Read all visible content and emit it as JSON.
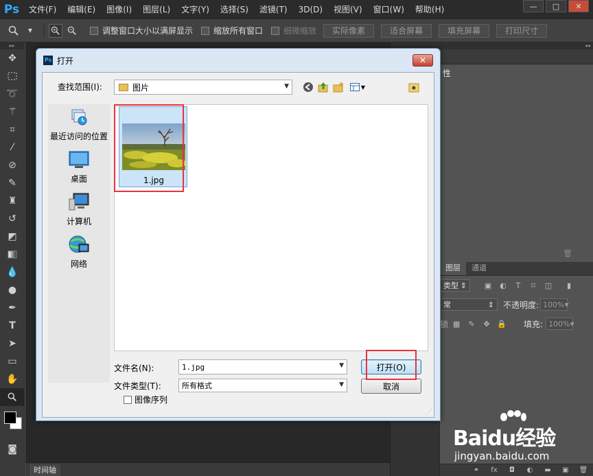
{
  "app": {
    "logo": "Ps",
    "menus": [
      "文件(F)",
      "编辑(E)",
      "图像(I)",
      "图层(L)",
      "文字(Y)",
      "选择(S)",
      "滤镜(T)",
      "3D(D)",
      "视图(V)",
      "窗口(W)",
      "帮助(H)"
    ],
    "window_controls": {
      "minimize": "—",
      "maximize": "□",
      "close": "✕"
    }
  },
  "options_bar": {
    "resize_windows_label": "调整窗口大小以满屏显示",
    "zoom_all_label": "缩放所有窗口",
    "scrubby_label": "细微缩放",
    "actual_pixels": "实际像素",
    "fit_screen": "适合屏幕",
    "fill_screen": "填充屏幕",
    "print_size": "打印尺寸"
  },
  "panels": {
    "properties_title": "性",
    "layers_tab": "图层",
    "channels_tab": "通道",
    "kind_label": "类型",
    "blend_mode": "常",
    "opacity_label": "不透明度:",
    "opacity_value": "100%",
    "lock_label": "锁",
    "fill_label": "填充:",
    "fill_value": "100%"
  },
  "timeline": {
    "label": "时间轴"
  },
  "dialog": {
    "title": "打开",
    "look_in_label": "查找范围(I):",
    "look_in_value": "图片",
    "places": [
      {
        "label": "最近访问的位置",
        "icon": "recent-places-icon"
      },
      {
        "label": "桌面",
        "icon": "desktop-icon"
      },
      {
        "label": "计算机",
        "icon": "computer-icon"
      },
      {
        "label": "网络",
        "icon": "network-icon"
      }
    ],
    "files": [
      {
        "name": "1.jpg",
        "selected": true
      }
    ],
    "file_name_label": "文件名(N):",
    "file_name_value": "1.jpg",
    "file_type_label": "文件类型(T):",
    "file_type_value": "所有格式",
    "open_button": "打开(O)",
    "cancel_button": "取消",
    "image_sequence_label": "图像序列",
    "image_sequence_checked": false,
    "close_label": "✕"
  },
  "watermark": {
    "brand": "Baidu经验",
    "url": "jingyan.baidu.com"
  },
  "colors": {
    "highlight": "#e8323c",
    "ps_blue": "#31a8ff",
    "selection": "#cce4f7"
  }
}
